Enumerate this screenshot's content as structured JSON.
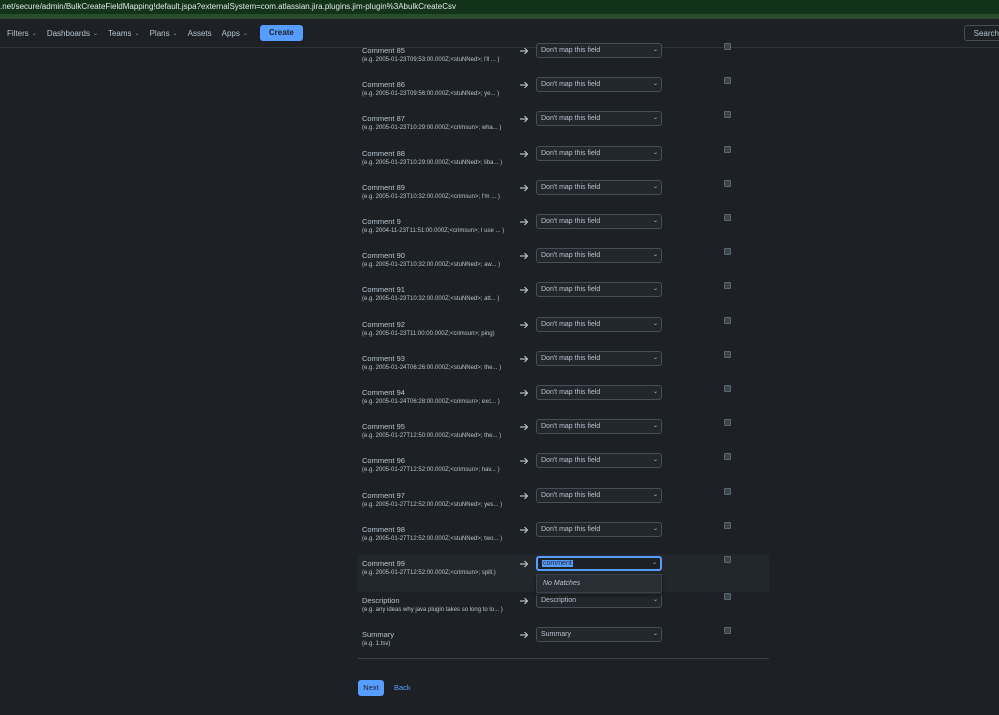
{
  "browser": {
    "url": ".net/secure/admin/BulkCreateFieldMapping!default.jspa?externalSystem=com.atlassian.jira.plugins.jim-plugin%3AbulkCreateCsv"
  },
  "nav": {
    "items": [
      {
        "label": "Filters",
        "has_chevron": true
      },
      {
        "label": "Dashboards",
        "has_chevron": true
      },
      {
        "label": "Teams",
        "has_chevron": true
      },
      {
        "label": "Plans",
        "has_chevron": true
      },
      {
        "label": "Assets",
        "has_chevron": false
      },
      {
        "label": "Apps",
        "has_chevron": true
      }
    ],
    "create_label": "Create",
    "search_placeholder": "Search"
  },
  "mappings": [
    {
      "name": "Comment 85",
      "example": "(e.g.  2005-01-23T09:53:00.000Z;<stuNNed>; i'll ... )",
      "value": "Don't map this field"
    },
    {
      "name": "Comment 86",
      "example": "(e.g.  2005-01-23T09:56:00.000Z;<stuNNed>; ye... )",
      "value": "Don't map this field"
    },
    {
      "name": "Comment 87",
      "example": "(e.g.  2005-01-23T10:29:00.000Z;<crimsun>; wha... )",
      "value": "Don't map this field"
    },
    {
      "name": "Comment 88",
      "example": "(e.g.  2005-01-23T10:29:00.000Z;<stuNNed>; liba... )",
      "value": "Don't map this field"
    },
    {
      "name": "Comment 89",
      "example": "(e.g.  2005-01-23T10:32:00.000Z;<crimsun>; I'm ... )",
      "value": "Don't map this field"
    },
    {
      "name": "Comment 9",
      "example": "(e.g.  2004-11-23T11:51:00.000Z;<crimsun>; I use ... )",
      "value": "Don't map this field"
    },
    {
      "name": "Comment 90",
      "example": "(e.g.  2005-01-23T10:32:00.000Z;<stuNNed>; aw... )",
      "value": "Don't map this field"
    },
    {
      "name": "Comment 91",
      "example": "(e.g.  2005-01-23T10:32:00.000Z;<stuNNed>; att... )",
      "value": "Don't map this field"
    },
    {
      "name": "Comment 92",
      "example": "(e.g.  2005-01-23T11:00:00.000Z;<crimsun>; ping)",
      "value": "Don't map this field"
    },
    {
      "name": "Comment 93",
      "example": "(e.g.  2005-01-24T06:26:00.000Z;<stuNNed>; the... )",
      "value": "Don't map this field"
    },
    {
      "name": "Comment 94",
      "example": "(e.g.  2005-01-24T06:28:00.000Z;<crimsun>; exc... )",
      "value": "Don't map this field"
    },
    {
      "name": "Comment 95",
      "example": "(e.g.  2005-01-27T12:50:00.000Z;<stuNNed>; the... )",
      "value": "Don't map this field"
    },
    {
      "name": "Comment 96",
      "example": "(e.g.  2005-01-27T12:52:00.000Z;<crimsun>; hav... )",
      "value": "Don't map this field"
    },
    {
      "name": "Comment 97",
      "example": "(e.g.  2005-01-27T12:52:00.000Z;<stuNNed>; yes... )",
      "value": "Don't map this field"
    },
    {
      "name": "Comment 98",
      "example": "(e.g.  2005-01-27T12:52:00.000Z;<stuNNed>; two... )",
      "value": "Don't map this field"
    },
    {
      "name": "Comment 99",
      "example": "(e.g.  2005-01-27T12:52:00.000Z;<crimsun>; spill.)",
      "value": "comment",
      "focused": true
    },
    {
      "name": "Description",
      "example": "(e.g.  any ideas why java plugin takes so long to lo... )",
      "value": "Description"
    },
    {
      "name": "Summary",
      "example": "(e.g.  1.tsv)",
      "value": "Summary"
    }
  ],
  "dropdown": {
    "no_matches": "No Matches"
  },
  "footer": {
    "next_label": "Next",
    "back_label": "Back"
  },
  "colors": {
    "accent": "#579dff",
    "background": "#1d2125",
    "url_bar": "#123318"
  },
  "icons": {
    "arrow": "arrow-right-icon",
    "chevron": "chevron-down-icon",
    "search": "search-icon"
  }
}
